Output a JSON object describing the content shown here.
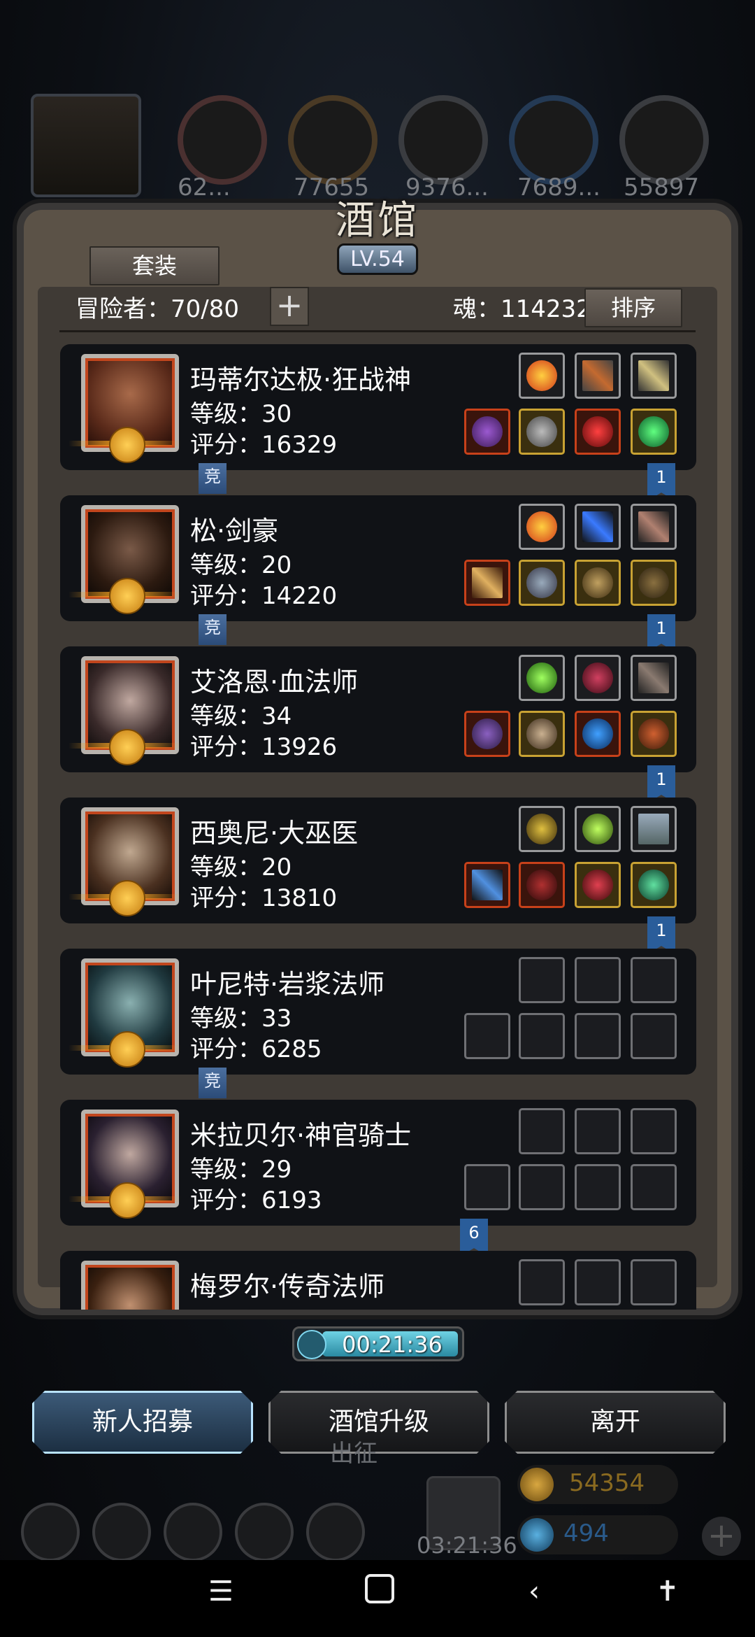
{
  "top_resources": {
    "values": [
      "62...",
      "77655",
      "9376...",
      "7689...",
      "55897"
    ]
  },
  "panel": {
    "title": "酒馆",
    "level": "LV.54",
    "set_button": "套装",
    "adventurers_label": "冒险者：70/80",
    "soul_label": "魂：114232",
    "sort_button": "排序"
  },
  "heroes": [
    {
      "name": "玛蒂尔达极·狂战神",
      "level": "等级：30",
      "score": "评分：16329",
      "tag": "竞",
      "rank": "1"
    },
    {
      "name": "松·剑豪",
      "level": "等级：20",
      "score": "评分：14220",
      "tag": "竞",
      "rank": "1"
    },
    {
      "name": "艾洛恩·血法师",
      "level": "等级：34",
      "score": "评分：13926",
      "tag": "",
      "rank": "1"
    },
    {
      "name": "西奥尼·大巫医",
      "level": "等级：20",
      "score": "评分：13810",
      "tag": "",
      "rank": "1"
    },
    {
      "name": "叶尼特·岩浆法师",
      "level": "等级：33",
      "score": "评分：6285",
      "tag": "竞",
      "rank": ""
    },
    {
      "name": "米拉贝尔·神官骑士",
      "level": "等级：29",
      "score": "评分：6193",
      "tag": "",
      "rank": "6"
    },
    {
      "name": "梅罗尔·传奇法师",
      "level": "",
      "score": "",
      "tag": "",
      "rank": ""
    }
  ],
  "timer": "00:21:36",
  "buttons": {
    "recruit": "新人招募",
    "upgrade": "酒馆升级",
    "leave": "离开"
  },
  "bottom": {
    "expedition": "出征",
    "gift_timer": "03:21:36",
    "gold": "54354",
    "gems": "494"
  },
  "colors": {
    "accent": "#6fc0ff",
    "frame_red": "#c7411a",
    "frame_gold": "#c8a233"
  }
}
